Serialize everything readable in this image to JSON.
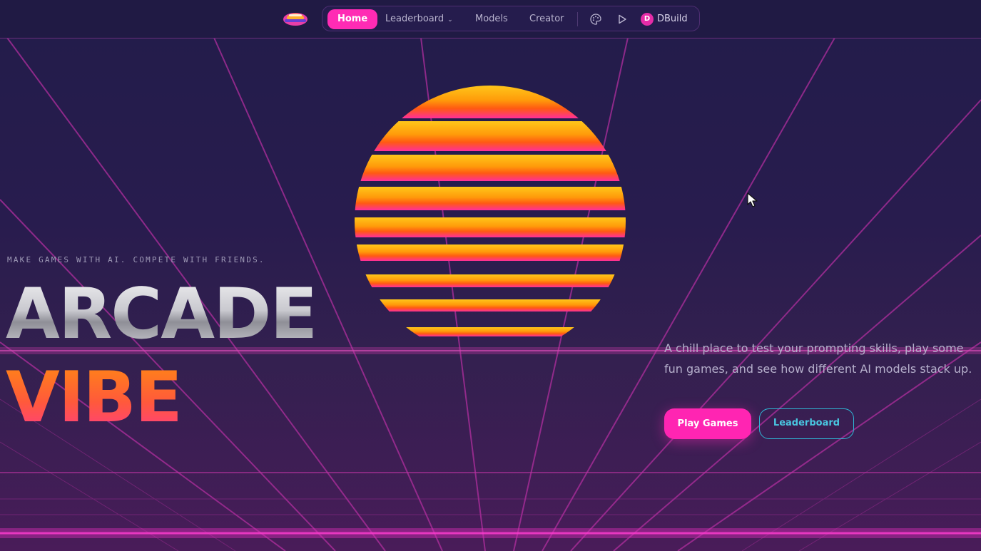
{
  "nav": {
    "home": "Home",
    "leaderboard": "Leaderboard",
    "models": "Models",
    "creator": "Creator",
    "user_initial": "D",
    "user_name": "DBuild",
    "icons": [
      "palette-icon",
      "play-icon",
      "chevron-down-icon"
    ]
  },
  "hero": {
    "tagline": "MAKE GAMES WITH AI. COMPETE WITH FRIENDS.",
    "title_line1": "ARCADE",
    "title_line2": "VIBE",
    "description": "A chill place to test your prompting skills, play some fun games, and see how different AI models stack up.",
    "cta_primary": "Play Games",
    "cta_secondary": "Leaderboard"
  },
  "colors": {
    "accent_pink": "#ff25b2",
    "accent_cyan": "#2fb8d6",
    "sun_top": "#ffc61a",
    "sun_bottom": "#ff2f9a",
    "background": "#221a48",
    "grid_line": "#b02e9e"
  }
}
